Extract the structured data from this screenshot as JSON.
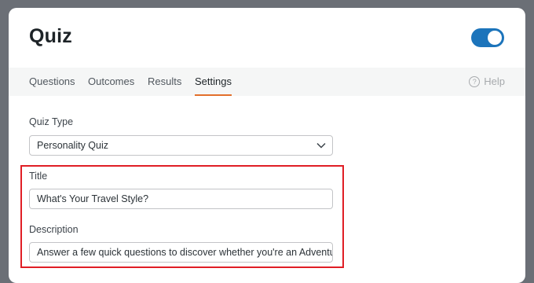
{
  "header": {
    "title": "Quiz"
  },
  "tabs": [
    {
      "label": "Questions"
    },
    {
      "label": "Outcomes"
    },
    {
      "label": "Results"
    },
    {
      "label": "Settings"
    }
  ],
  "help": {
    "icon_glyph": "?",
    "label": "Help"
  },
  "form": {
    "quiz_type_label": "Quiz Type",
    "quiz_type_value": "Personality Quiz",
    "title_label": "Title",
    "title_value": "What's Your Travel Style?",
    "description_label": "Description",
    "description_value": "Answer a few quick questions to discover whether you're an Adventurer"
  },
  "colors": {
    "toggle_on": "#1c74bb",
    "active_tab_underline": "#e26f2b",
    "highlight_border": "#e01e25",
    "backdrop": "#6b6f76"
  },
  "toggle": {
    "enabled": true
  }
}
